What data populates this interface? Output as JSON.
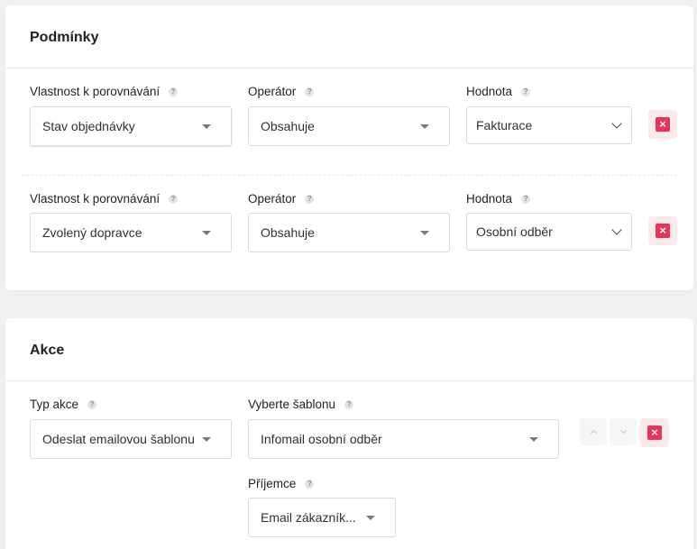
{
  "conditions": {
    "title": "Podmínky",
    "rows": [
      {
        "property_label": "Vlastnost k porovnávání",
        "property_value": "Stav objednávky",
        "operator_label": "Operátor",
        "operator_value": "Obsahuje",
        "value_label": "Hodnota",
        "value_value": "Fakturace"
      },
      {
        "property_label": "Vlastnost k porovnávání",
        "property_value": "Zvolený dopravce",
        "operator_label": "Operátor",
        "operator_value": "Obsahuje",
        "value_label": "Hodnota",
        "value_value": "Osobní odběr"
      }
    ]
  },
  "actions": {
    "title": "Akce",
    "type_label": "Typ akce",
    "type_value": "Odeslat emailovou šablonu",
    "template_label": "Vyberte šablonu",
    "template_value": "Infomail osobní odběr",
    "recipient_label": "Příjemce",
    "recipient_value": "Email zákazník..."
  },
  "help_glyph": "?",
  "delete_glyph": "×",
  "colors": {
    "delete": "#e8335d",
    "delete_bg": "#fbe9ec"
  }
}
